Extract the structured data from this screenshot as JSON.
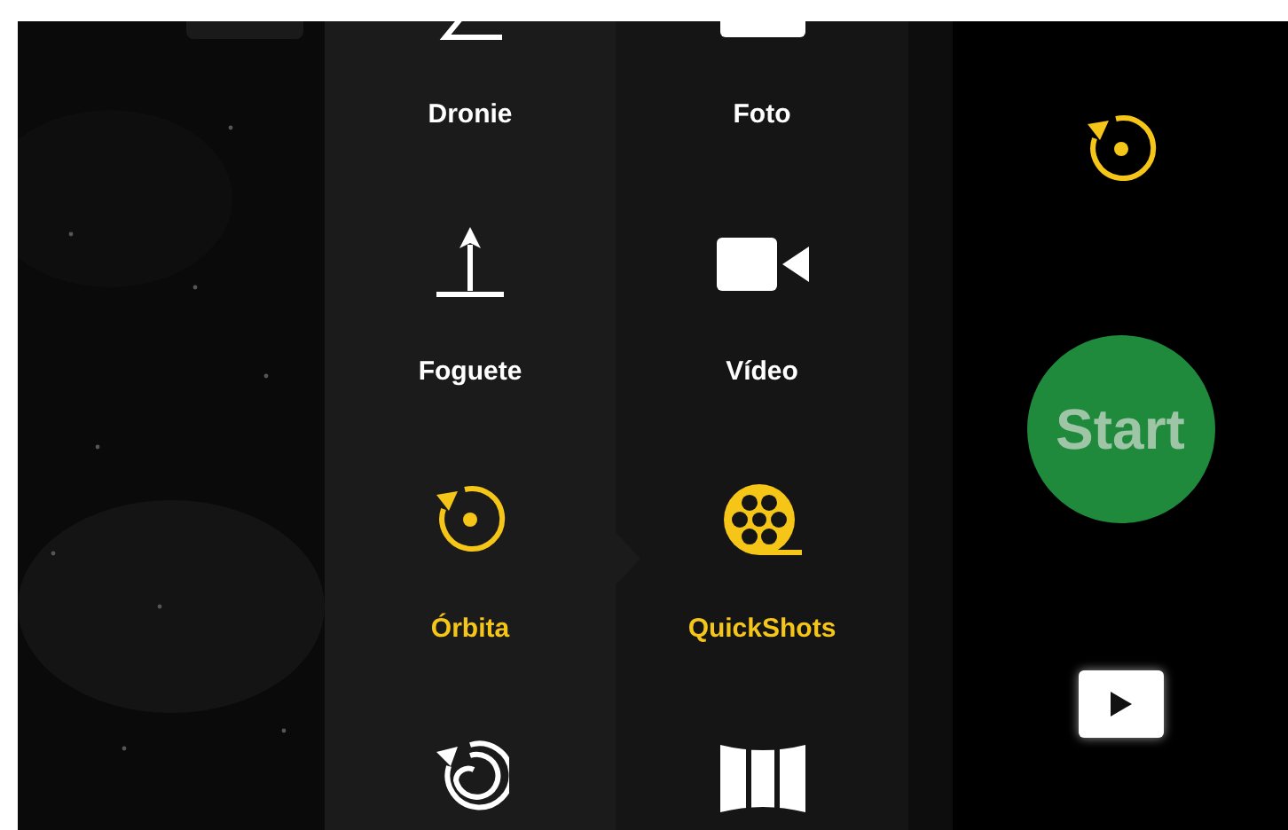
{
  "mode_menu": {
    "columns": [
      {
        "items": [
          {
            "kind": "dronie",
            "label": "Dronie",
            "selected": false
          },
          {
            "kind": "rocket",
            "label": "Foguete",
            "selected": false
          },
          {
            "kind": "orbit",
            "label": "Órbita",
            "selected": true
          },
          {
            "kind": "helix",
            "selected": false
          }
        ]
      },
      {
        "items": [
          {
            "label": "Foto",
            "selected": false
          },
          {
            "kind": "video",
            "label": "Vídeo",
            "selected": false
          },
          {
            "kind": "quickshots",
            "label": "QuickShots",
            "selected": true
          },
          {
            "kind": "panorama",
            "selected": false
          }
        ]
      }
    ]
  },
  "side_panel": {
    "start_button": "Start"
  }
}
